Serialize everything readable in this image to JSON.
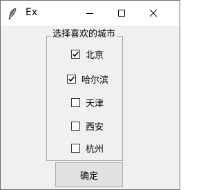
{
  "window": {
    "title": "Ex",
    "icon": "feather-icon"
  },
  "titlebar_buttons": {
    "minimize_icon": "minimize-icon",
    "maximize_icon": "maximize-icon",
    "close_icon": "close-icon"
  },
  "group": {
    "title": "选择喜欢的城市",
    "options": [
      {
        "label": "北京",
        "checked": true
      },
      {
        "label": "哈尔滨",
        "checked": true
      },
      {
        "label": "天津",
        "checked": false
      },
      {
        "label": "西安",
        "checked": false
      },
      {
        "label": "杭州",
        "checked": false
      }
    ]
  },
  "actions": {
    "ok_label": "确定"
  },
  "colors": {
    "window_bg": "#f0f0f0",
    "titlebar_bg": "#ffffff",
    "button_bg": "#e1e1e1",
    "frame_border": "#a8a8a8"
  }
}
